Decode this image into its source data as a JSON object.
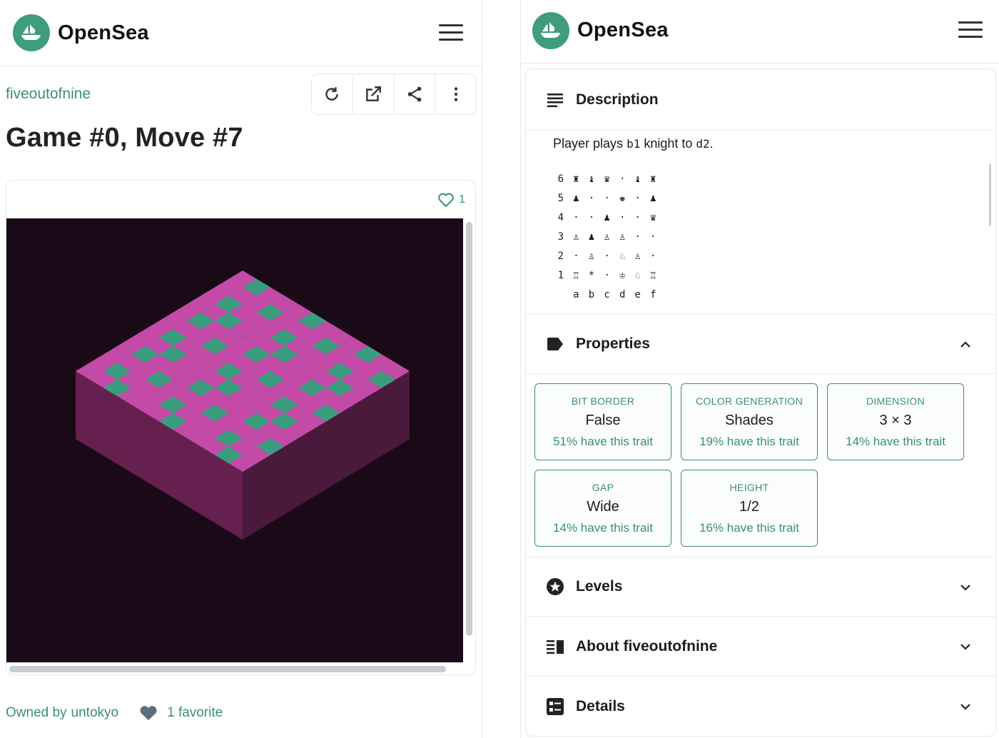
{
  "brand": "OpenSea",
  "colors": {
    "accent": "#3a8f74",
    "logo": "#3f9c7f",
    "art_bg": "#1a0a17",
    "tile_top": "#c44aa8",
    "tile_green": "#3a9e7e",
    "tile_left": "#66204f",
    "tile_right": "#4a1a3d"
  },
  "asset": {
    "collection": "fiveoutofnine",
    "title": "Game #0, Move #7",
    "favorites_count": "1",
    "owner_label": "Owned by",
    "owner": "untokyo",
    "favorite_text": "1 favorite"
  },
  "toolbar": {
    "icons": [
      "refresh-icon",
      "external-link-icon",
      "share-icon",
      "more-icon"
    ]
  },
  "description": {
    "title": "Description",
    "text_prefix": "Player plays",
    "from_square": "b1",
    "text_mid": "knight to",
    "to_square": "d2",
    "text_suffix": ".",
    "board": [
      [
        "6",
        "♜",
        "♝",
        "♛",
        "·",
        "♝",
        "♜"
      ],
      [
        "5",
        "♟",
        "·",
        "·",
        "♚",
        "·",
        "♟"
      ],
      [
        "4",
        "·",
        "·",
        "♟",
        "·",
        "·",
        "♛"
      ],
      [
        "3",
        "♙",
        "♟",
        "♙",
        "♙",
        "·",
        "·"
      ],
      [
        "2",
        "·",
        "♙",
        "·",
        "♘",
        "♙",
        "·"
      ],
      [
        "1",
        "♖",
        "*",
        "·",
        "♔",
        "♘",
        "♖"
      ]
    ],
    "files": [
      "",
      "a",
      "b",
      "c",
      "d",
      "e",
      "f"
    ]
  },
  "properties": {
    "title": "Properties",
    "traits": [
      {
        "type": "Bit Border",
        "value": "False",
        "rarity": "51% have this trait"
      },
      {
        "type": "Color Generation",
        "value": "Shades",
        "rarity": "19% have this trait"
      },
      {
        "type": "Dimension",
        "value": "3 × 3",
        "rarity": "14% have this trait"
      },
      {
        "type": "Gap",
        "value": "Wide",
        "rarity": "14% have this trait"
      },
      {
        "type": "Height",
        "value": "1/2",
        "rarity": "16% have this trait"
      }
    ]
  },
  "sections": {
    "levels": "Levels",
    "about": "About fiveoutofnine",
    "details": "Details"
  }
}
